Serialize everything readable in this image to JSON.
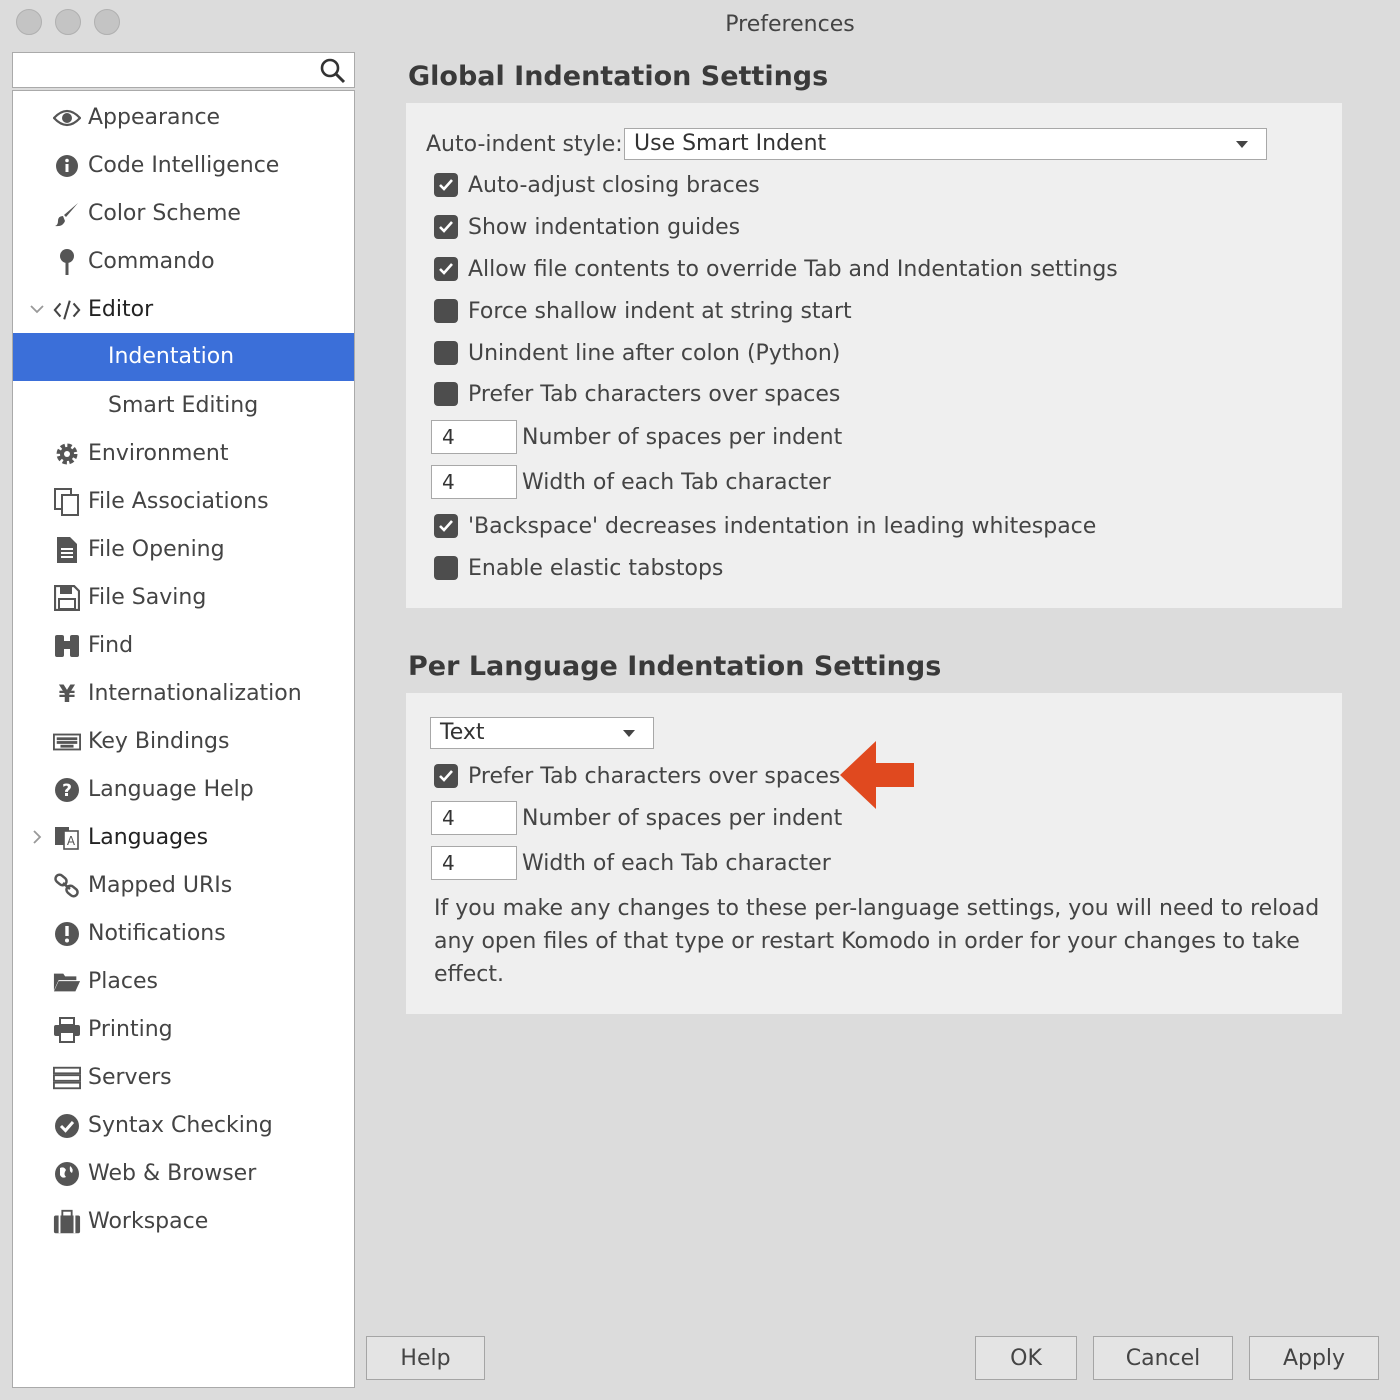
{
  "window": {
    "title": "Preferences"
  },
  "search": {
    "placeholder": "",
    "value": ""
  },
  "sidebar": {
    "items": [
      {
        "label": "Appearance",
        "icon": "eye-icon"
      },
      {
        "label": "Code Intelligence",
        "icon": "info-icon"
      },
      {
        "label": "Color Scheme",
        "icon": "brush-icon"
      },
      {
        "label": "Commando",
        "icon": "pin-icon"
      },
      {
        "label": "Editor",
        "icon": "code-icon",
        "expanded": true
      },
      {
        "label": "Indentation",
        "selected": true
      },
      {
        "label": "Smart Editing"
      },
      {
        "label": "Environment",
        "icon": "gear-icon"
      },
      {
        "label": "File Associations",
        "icon": "copy-icon"
      },
      {
        "label": "File Opening",
        "icon": "document-icon"
      },
      {
        "label": "File Saving",
        "icon": "floppy-icon"
      },
      {
        "label": "Find",
        "icon": "binoculars-icon"
      },
      {
        "label": "Internationalization",
        "icon": "yen-icon"
      },
      {
        "label": "Key Bindings",
        "icon": "keyboard-icon"
      },
      {
        "label": "Language Help",
        "icon": "question-icon"
      },
      {
        "label": "Languages",
        "icon": "translate-icon",
        "collapsed": true
      },
      {
        "label": "Mapped URIs",
        "icon": "link-icon"
      },
      {
        "label": "Notifications",
        "icon": "alert-icon"
      },
      {
        "label": "Places",
        "icon": "folder-icon"
      },
      {
        "label": "Printing",
        "icon": "printer-icon"
      },
      {
        "label": "Servers",
        "icon": "server-icon"
      },
      {
        "label": "Syntax Checking",
        "icon": "check-circle-icon"
      },
      {
        "label": "Web & Browser",
        "icon": "globe-icon"
      },
      {
        "label": "Workspace",
        "icon": "briefcase-icon"
      }
    ]
  },
  "global": {
    "heading": "Global Indentation Settings",
    "auto_indent_label": "Auto-indent style:",
    "auto_indent_value": "Use Smart Indent",
    "auto_adjust": {
      "label": "Auto-adjust closing braces",
      "checked": true
    },
    "show_guides": {
      "label": "Show indentation guides",
      "checked": true
    },
    "allow_override": {
      "label": "Allow file contents to override Tab and Indentation settings",
      "checked": true
    },
    "force_shallow": {
      "label": "Force shallow indent at string start",
      "checked": false
    },
    "unindent_colon": {
      "label": "Unindent line after colon (Python)",
      "checked": false
    },
    "prefer_tabs": {
      "label": "Prefer Tab characters over spaces",
      "checked": false
    },
    "spaces_per_indent": {
      "value": "4",
      "label": "Number of spaces per indent"
    },
    "tab_width": {
      "value": "4",
      "label": "Width of each Tab character"
    },
    "backspace": {
      "label": "'Backspace' decreases indentation in leading whitespace",
      "checked": true
    },
    "elastic": {
      "label": "Enable elastic tabstops",
      "checked": false
    }
  },
  "per_language": {
    "heading": "Per Language Indentation Settings",
    "language": "Text",
    "prefer_tabs": {
      "label": "Prefer Tab characters over spaces",
      "checked": true
    },
    "spaces_per_indent": {
      "value": "4",
      "label": "Number of spaces per indent"
    },
    "tab_width": {
      "value": "4",
      "label": "Width of each Tab character"
    },
    "note": "If you make any changes to these per-language settings, you will need to reload any open files of that type or restart Komodo in order for your changes to take effect."
  },
  "annotation_arrow_color": "#e0491f",
  "selection_color": "#3b6fd9",
  "buttons": {
    "help": "Help",
    "ok": "OK",
    "cancel": "Cancel",
    "apply": "Apply"
  }
}
